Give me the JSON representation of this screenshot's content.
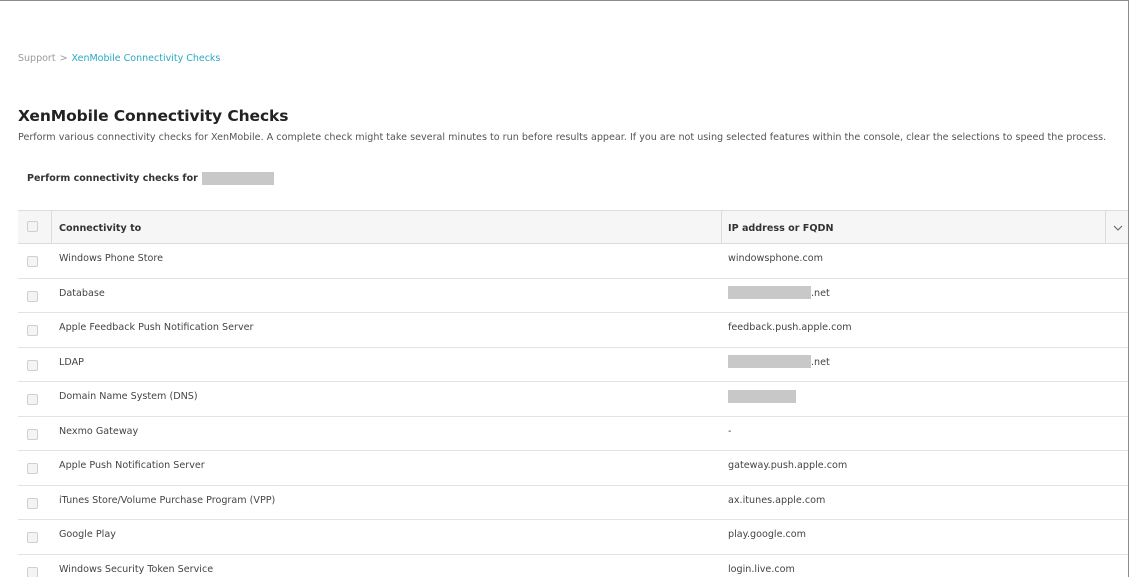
{
  "breadcrumb": {
    "parent": "Support",
    "separator": ">",
    "current": "XenMobile Connectivity Checks"
  },
  "page": {
    "title": "XenMobile Connectivity Checks",
    "description": "Perform various connectivity checks for XenMobile. A complete check might take several minutes to run before results appear. If you are not using selected features within the console, clear the selections to speed the process.",
    "checks_for_label": "Perform connectivity checks for"
  },
  "table": {
    "headers": {
      "connectivity_to": "Connectivity to",
      "ip_address": "IP address or FQDN"
    },
    "rows": [
      {
        "name": "Windows Phone Store",
        "address": "windowsphone.com",
        "redacted": false
      },
      {
        "name": "Database",
        "address": ".net",
        "redacted": true
      },
      {
        "name": "Apple Feedback Push Notification Server",
        "address": "feedback.push.apple.com",
        "redacted": false
      },
      {
        "name": "LDAP",
        "address": ".net",
        "redacted": true
      },
      {
        "name": "Domain Name System (DNS)",
        "address": "",
        "redacted": true
      },
      {
        "name": "Nexmo Gateway",
        "address": "-",
        "redacted": false
      },
      {
        "name": "Apple Push Notification Server",
        "address": "gateway.push.apple.com",
        "redacted": false
      },
      {
        "name": "iTunes Store/Volume Purchase Program (VPP)",
        "address": "ax.itunes.apple.com",
        "redacted": false
      },
      {
        "name": "Google Play",
        "address": "play.google.com",
        "redacted": false
      },
      {
        "name": "Windows Security Token Service",
        "address": "login.live.com",
        "redacted": false
      }
    ]
  },
  "icons": {
    "column_menu": "chevron-down-icon"
  },
  "colors": {
    "accent": "#29a9c1",
    "redaction": "#c8c8c8"
  }
}
